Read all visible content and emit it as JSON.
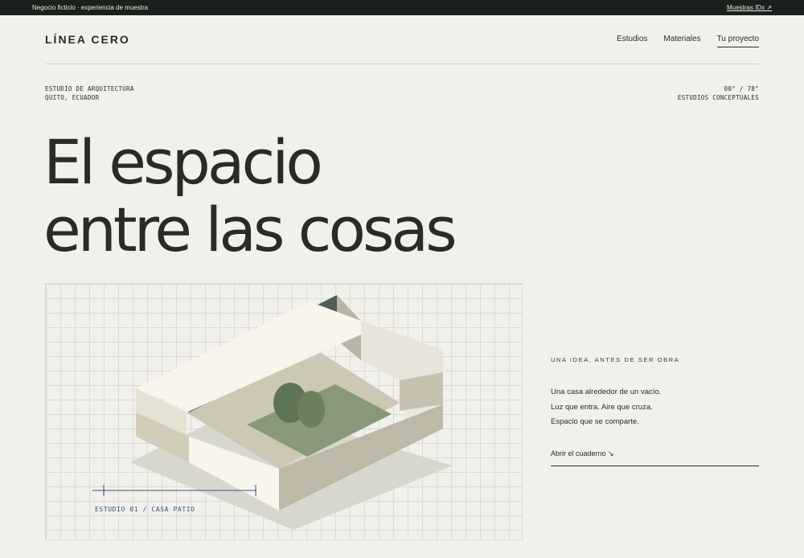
{
  "topbar": {
    "notice": "Negocio ficticio · experiencia de muestra",
    "link": "Muestras IDx ↗"
  },
  "header": {
    "brand": "LÍNEA CERO",
    "nav": [
      {
        "label": "Estudios"
      },
      {
        "label": "Materiales"
      },
      {
        "label": "Tu proyecto",
        "active": true
      }
    ]
  },
  "meta": {
    "left": [
      "ESTUDIO DE ARQUITECTURA",
      "QUITO, ECUADOR"
    ],
    "right": [
      "00° / 78°",
      "ESTUDIOS CONCEPTUALES"
    ]
  },
  "hero": {
    "line1": "El espacio",
    "line2": "entre las cosas"
  },
  "drawing": {
    "caption": "ESTUDIO 01 / CASA PATIO",
    "accent": "#34508a"
  },
  "side": {
    "eyebrow": "UNA IDEA, ANTES DE SER OBRA",
    "lines": [
      "Una casa alrededor de un vacío.",
      "Luz que entra. Aire que cruza.",
      "Espacio que se comparte."
    ],
    "cta": "Abrir el cuaderno ↘"
  }
}
